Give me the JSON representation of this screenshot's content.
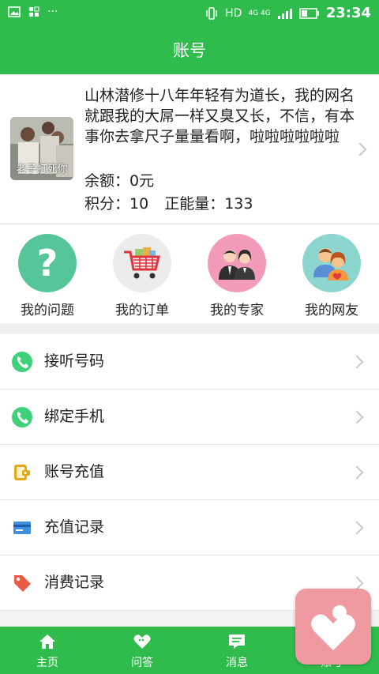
{
  "status_bar": {
    "network": "HD",
    "signal": "4G 4G",
    "time": "23:34",
    "more": "···"
  },
  "app_bar": {
    "title": "账号"
  },
  "profile": {
    "avatar_caption": "老子打死你",
    "motto": "山林潜修十八年年轻有为道长，我的网名就跟我的大屌一样又臭又长，不信，有本事你去拿尺子量量看啊，啦啦啦啦啦啦",
    "balance": "余额：0元",
    "points": "积分：10",
    "energy": "正能量：133"
  },
  "quick_links": [
    {
      "label": "我的问题",
      "icon": "question-icon",
      "color": "#56c69a"
    },
    {
      "label": "我的订单",
      "icon": "cart-icon",
      "color": "#ececec"
    },
    {
      "label": "我的专家",
      "icon": "expert-icon",
      "color": "#f29ab9"
    },
    {
      "label": "我的网友",
      "icon": "friends-icon",
      "color": "#8cd6cf"
    }
  ],
  "menu": [
    {
      "label": "接听号码",
      "icon": "phone-icon"
    },
    {
      "label": "绑定手机",
      "icon": "phone-icon"
    },
    {
      "label": "账号充值",
      "icon": "wallet-icon"
    },
    {
      "label": "充值记录",
      "icon": "card-icon"
    },
    {
      "label": "消费记录",
      "icon": "tag-icon"
    }
  ],
  "tabs": [
    {
      "label": "主页",
      "icon": "home-icon"
    },
    {
      "label": "问答",
      "icon": "heart-chat-icon"
    },
    {
      "label": "消息",
      "icon": "message-icon"
    },
    {
      "label": "账号",
      "icon": "account-icon"
    }
  ],
  "colors": {
    "brand": "#2fbc4c",
    "fab": "#ee9aa0"
  }
}
